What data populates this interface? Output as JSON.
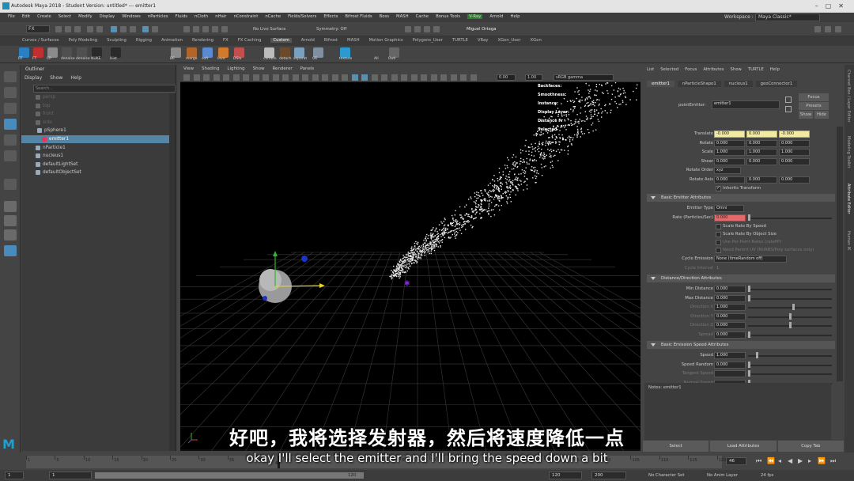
{
  "title_bar": {
    "title": "Autodesk Maya 2018 - Student Version: untitled*  ---  emitter1"
  },
  "menu_bar": {
    "items": [
      "File",
      "Edit",
      "Create",
      "Select",
      "Modify",
      "Display",
      "Windows",
      "nParticles",
      "Fluids",
      "nCloth",
      "nHair",
      "nConstraint",
      "nCache",
      "Fields/Solvers",
      "Effects",
      "Bifrost Fluids",
      "Boss",
      "MASH",
      "Cache",
      "Bonus Tools"
    ],
    "vray": "V-Ray",
    "items_after": [
      "Arnold",
      "Help"
    ],
    "workspace_label": "Workspace :",
    "workspace_value": "Maya Classic*"
  },
  "status_line": {
    "menuset": "FX",
    "live_surface": "No Live Surface",
    "symmetry": "Symmetry: Off",
    "user": "Miguel Ortega"
  },
  "shelf_tabs": [
    "Curves / Surfaces",
    "Poly Modeling",
    "Sculpting",
    "Rigging",
    "Animation",
    "Rendering",
    "FX",
    "FX Caching",
    "Custom",
    "Arnold",
    "Bifrost",
    "MASH",
    "Motion Graphics",
    "Polygons_User",
    "TURTLE",
    "VRay",
    "XGen_User",
    "XGen"
  ],
  "shelf_active": "Custom",
  "shelf_labels": [
    "RT",
    "FT",
    "CP",
    "denoise",
    "denoise",
    "NUKE",
    "Hist",
    "BE",
    "merge",
    "soft",
    "Inve",
    "DSlo",
    "combin",
    "detach",
    "separat",
    "GE",
    "texture",
    "All",
    "Outl"
  ],
  "outliner": {
    "title": "Outliner",
    "menu": [
      "Display",
      "Show",
      "Help"
    ],
    "search_placeholder": "Search...",
    "rows": [
      {
        "label": "persp",
        "state": "dim"
      },
      {
        "label": "top",
        "state": "dim"
      },
      {
        "label": "front",
        "state": "dim"
      },
      {
        "label": "side",
        "state": "dim"
      },
      {
        "label": "pSphere1",
        "state": "normal"
      },
      {
        "label": "emitter1",
        "state": "selected"
      },
      {
        "label": "nParticle1",
        "state": "normal"
      },
      {
        "label": "nucleus1",
        "state": "normal"
      },
      {
        "label": "defaultLightSet",
        "state": "normal"
      },
      {
        "label": "defaultObjectSet",
        "state": "normal"
      }
    ]
  },
  "viewport": {
    "menu": [
      "View",
      "Shading",
      "Lighting",
      "Show",
      "Renderer",
      "Panels"
    ],
    "field_a": "0.00",
    "field_b": "1.00",
    "color_space": "sRGB gamma",
    "hud": [
      "Backfaces:",
      "Smoothness:",
      "Instance:",
      "Display Layer:",
      "Distance Fr",
      "Selected"
    ]
  },
  "attribute_editor": {
    "menu": [
      "List",
      "Selected",
      "Focus",
      "Attributes",
      "Show",
      "TURTLE",
      "Help"
    ],
    "tabs": [
      "emitter1",
      "nParticleShape1",
      "nucleus1",
      "geoConnector1"
    ],
    "node_type_label": "pointEmitter:",
    "node_name": "emitter1",
    "buttons": {
      "focus": "Focus",
      "presets": "Presets",
      "show": "Show",
      "hide": "Hide"
    },
    "transform": [
      {
        "label": "Translate",
        "values": [
          "-0.000",
          "0.000",
          "-0.000"
        ]
      },
      {
        "label": "Rotate",
        "values": [
          "0.000",
          "0.000",
          "0.000"
        ]
      },
      {
        "label": "Scale",
        "values": [
          "1.000",
          "1.000",
          "1.000"
        ]
      },
      {
        "label": "Shear",
        "values": [
          "0.000",
          "0.000",
          "0.000"
        ]
      }
    ],
    "rotate_order_label": "Rotate Order",
    "rotate_order": "xyz",
    "rotate_axis_label": "Rotate Axis",
    "rotate_axis": [
      "0.000",
      "0.000",
      "0.000"
    ],
    "inherits_transform": "Inherits Transform",
    "sections": [
      "Basic Emitter Attributes",
      "Distance/Direction Attributes",
      "Basic Emission Speed Attributes"
    ],
    "emitter_type_label": "Emitter Type",
    "emitter_type": "Omni",
    "rate_label": "Rate (Particles/Sec)",
    "rate": "0.000",
    "checkboxes": [
      "Scale Rate By Speed",
      "Scale Rate By Object Size",
      "Use Per-Point Rates (ratePP)",
      "Need Parent UV (NURBS/Poly surfaces only)"
    ],
    "cycle_emission_label": "Cycle Emission",
    "cycle_emission": "None (timeRandom off)",
    "cycle_interval_label": "Cycle Interval",
    "cycle_interval": "1",
    "distance": [
      {
        "label": "Min Distance",
        "value": "0.000",
        "enabled": true
      },
      {
        "label": "Max Distance",
        "value": "0.000",
        "enabled": true
      },
      {
        "label": "Direction X",
        "value": "1.000",
        "enabled": false
      },
      {
        "label": "Direction Y",
        "value": "0.000",
        "enabled": false
      },
      {
        "label": "Direction Z",
        "value": "0.000",
        "enabled": false
      },
      {
        "label": "Spread",
        "value": "0.000",
        "enabled": false
      }
    ],
    "speed": [
      {
        "label": "Speed",
        "value": "1.000",
        "enabled": true
      },
      {
        "label": "Speed Random",
        "value": "0.000",
        "enabled": true
      },
      {
        "label": "Tangent Speed",
        "value": "",
        "enabled": false
      },
      {
        "label": "Normal Speed",
        "value": "",
        "enabled": false
      }
    ],
    "notes": "Notes:  emitter1",
    "bottom_buttons": [
      "Select",
      "Load Attributes",
      "Copy Tab"
    ]
  },
  "right_tabs": [
    "Channel Box / Layer Editor",
    "Modeling Toolkit",
    "Attribute Editor",
    "Human IK"
  ],
  "timeline": {
    "ticks": [
      "1",
      "5",
      "10",
      "15",
      "20",
      "25",
      "30",
      "35",
      "40",
      "45",
      "50",
      "55",
      "60",
      "65",
      "70",
      "75",
      "80",
      "85",
      "90",
      "95",
      "100",
      "105",
      "110",
      "115",
      "120"
    ],
    "current": "46",
    "current_field": "46"
  },
  "range": {
    "start": "1",
    "start2": "1",
    "end_inner": "120",
    "end": "120",
    "end2": "200",
    "character_set": "No Character Set",
    "anim_layer": "No Anim Layer",
    "fps": "24 fps"
  },
  "subtitles": {
    "chinese": "好吧，我将选择发射器，然后将速度降低一点",
    "english": "okay I'll select the emitter and I'll bring the speed down a bit"
  }
}
